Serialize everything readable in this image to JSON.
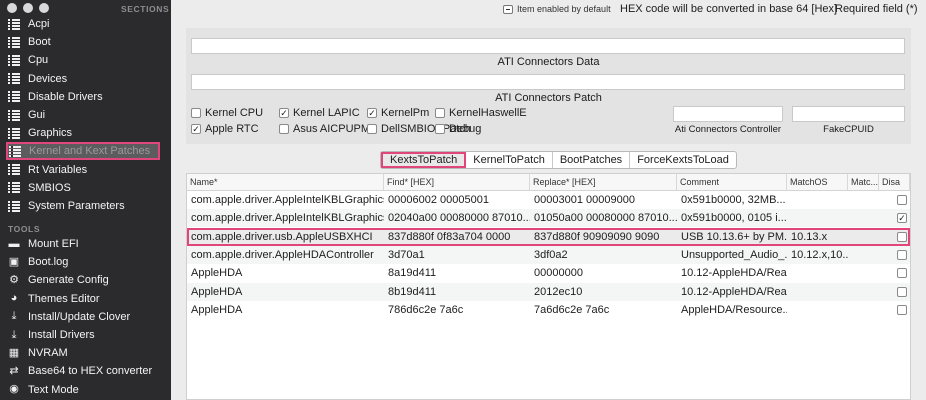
{
  "sidebar": {
    "sections_label": "SECTIONS",
    "tools_label": "TOOLS",
    "sections": [
      {
        "label": "Acpi",
        "icon": "list-icon"
      },
      {
        "label": "Boot",
        "icon": "list-icon"
      },
      {
        "label": "Cpu",
        "icon": "list-icon"
      },
      {
        "label": "Devices",
        "icon": "list-icon"
      },
      {
        "label": "Disable Drivers",
        "icon": "list-icon"
      },
      {
        "label": "Gui",
        "icon": "list-icon"
      },
      {
        "label": "Graphics",
        "icon": "list-icon"
      },
      {
        "label": "Kernel and Kext Patches",
        "icon": "list-icon",
        "selected": true
      },
      {
        "label": "Rt Variables",
        "icon": "list-icon"
      },
      {
        "label": "SMBIOS",
        "icon": "list-icon"
      },
      {
        "label": "System Parameters",
        "icon": "list-icon"
      }
    ],
    "tools": [
      {
        "label": "Mount EFI",
        "icon": "drive-icon",
        "glyph": "▬"
      },
      {
        "label": "Boot.log",
        "icon": "terminal-icon",
        "glyph": "▣"
      },
      {
        "label": "Generate Config",
        "icon": "gear-icon",
        "glyph": "⚙"
      },
      {
        "label": "Themes Editor",
        "icon": "palette-icon",
        "glyph": "◕"
      },
      {
        "label": "Install/Update Clover",
        "icon": "download-icon",
        "glyph": "⤓"
      },
      {
        "label": "Install Drivers",
        "icon": "download-icon",
        "glyph": "⤓"
      },
      {
        "label": "NVRAM",
        "icon": "chip-icon",
        "glyph": "▦"
      },
      {
        "label": "Base64 to HEX converter",
        "icon": "convert-icon",
        "glyph": "⇄"
      },
      {
        "label": "Text Mode",
        "icon": "eye-icon",
        "glyph": "◉"
      }
    ]
  },
  "topbar": {
    "enabled_label": "Item enabled by default",
    "hex_label": "HEX code will be converted in base 64 [Hex]",
    "required_label": "Required field (*)"
  },
  "panel": {
    "ati_data_label": "ATI Connectors Data",
    "ati_patch_label": "ATI Connectors Patch",
    "ati_controller_label": "Ati Connectors Controller",
    "fake_cpuid_label": "FakeCPUID",
    "checkboxes": [
      {
        "label": "Kernel CPU",
        "checked": false
      },
      {
        "label": "Kernel LAPIC",
        "checked": true
      },
      {
        "label": "KernelPm",
        "checked": true
      },
      {
        "label": "KernelHaswellE",
        "checked": false
      },
      {
        "label": "Apple RTC",
        "checked": true
      },
      {
        "label": "Asus AICPUPM",
        "checked": false
      },
      {
        "label": "DellSMBIOSPatch",
        "checked": false
      },
      {
        "label": "Debug",
        "checked": false
      }
    ]
  },
  "tabs": [
    {
      "label": "KextsToPatch",
      "active": true
    },
    {
      "label": "KernelToPatch"
    },
    {
      "label": "BootPatches"
    },
    {
      "label": "ForceKextsToLoad"
    }
  ],
  "table": {
    "columns": [
      "Name*",
      "Find* [HEX]",
      "Replace* [HEX]",
      "Comment",
      "MatchOS",
      "Matc...",
      "Disa"
    ],
    "rows": [
      {
        "name": "com.apple.driver.AppleIntelKBLGraphics...",
        "find": "00006002 00005001",
        "replace": "00003001 00009000",
        "comment": "0x591b0000, 32MB...",
        "matchos": "",
        "disabled": false
      },
      {
        "name": "com.apple.driver.AppleIntelKBLGraphics...",
        "find": "02040a00 00080000 87010...",
        "replace": "01050a00 00080000 87010...",
        "comment": "0x591b0000, 0105 i...",
        "matchos": "",
        "disabled": true
      },
      {
        "name": "com.apple.driver.usb.AppleUSBXHCI",
        "find": "837d880f 0f83a704 0000",
        "replace": "837d880f 90909090 9090",
        "comment": "USB 10.13.6+ by PM...",
        "matchos": "10.13.x",
        "disabled": false,
        "highlighted": true
      },
      {
        "name": "com.apple.driver.AppleHDAController",
        "find": "3d70a1",
        "replace": "3df0a2",
        "comment": "Unsupported_Audio_...",
        "matchos": "10.12.x,10...",
        "disabled": false
      },
      {
        "name": "AppleHDA",
        "find": "8a19d411",
        "replace": "00000000",
        "comment": "10.12-AppleHDA/Rea...",
        "matchos": "",
        "disabled": false
      },
      {
        "name": "AppleHDA",
        "find": "8b19d411",
        "replace": "2012ec10",
        "comment": "10.12-AppleHDA/Rea...",
        "matchos": "",
        "disabled": false
      },
      {
        "name": "AppleHDA",
        "find": "786d6c2e 7a6c",
        "replace": "7a6d6c2e 7a6c",
        "comment": "AppleHDA/Resource...",
        "matchos": "",
        "disabled": false
      }
    ]
  }
}
